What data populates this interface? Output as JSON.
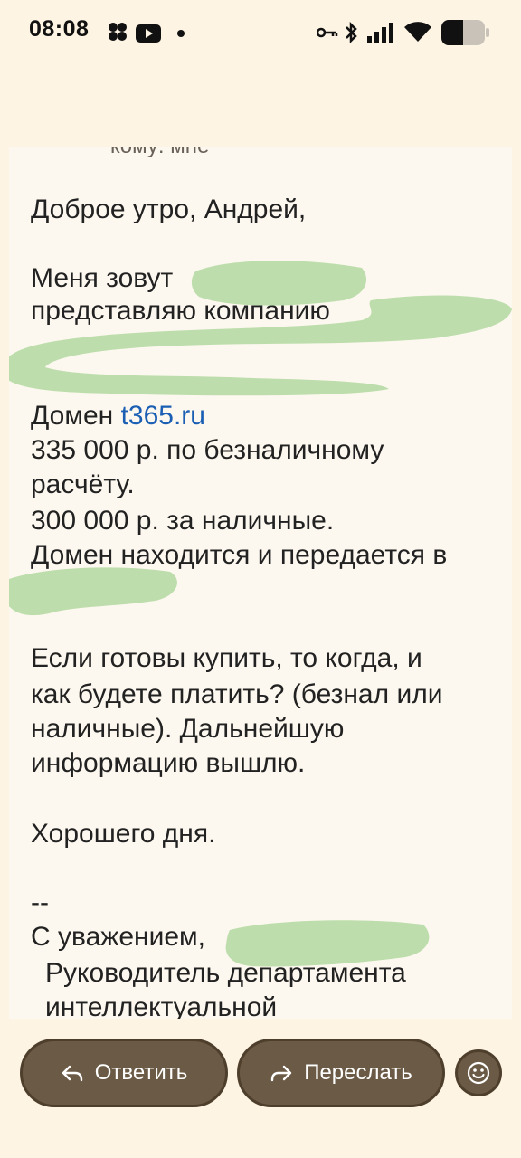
{
  "status_bar": {
    "time": "08:08"
  },
  "message": {
    "partial_header": "кому: мне",
    "lines": {
      "l1": "Доброе утро, Андрей,",
      "l2": "Меня зовут",
      "l3": "представляю компанию",
      "l4_prefix": "Домен ",
      "l4_link": "t365.ru",
      "l5": "335 000 р. по безналичному",
      "l6": "расчёту.",
      "l7": "300 000 р. за наличные.",
      "l8": "Домен находится и передается в",
      "l9": "Если готовы купить, то когда, и",
      "l10": "как будете платить? (безнал или",
      "l11": "наличные). Дальнейшую",
      "l12": "информацию вышлю.",
      "l13": "Хорошего дня.",
      "l14": "--",
      "l15": "С уважением,",
      "l16": "Руководитель департамента",
      "l17": "интеллектуальной"
    }
  },
  "actions": {
    "reply": "Ответить",
    "forward": "Переслать"
  },
  "colors": {
    "background": "#fdf4e3",
    "pill": "#6b5a45",
    "link": "#1a5fb4",
    "redaction": "#b8dca7"
  }
}
